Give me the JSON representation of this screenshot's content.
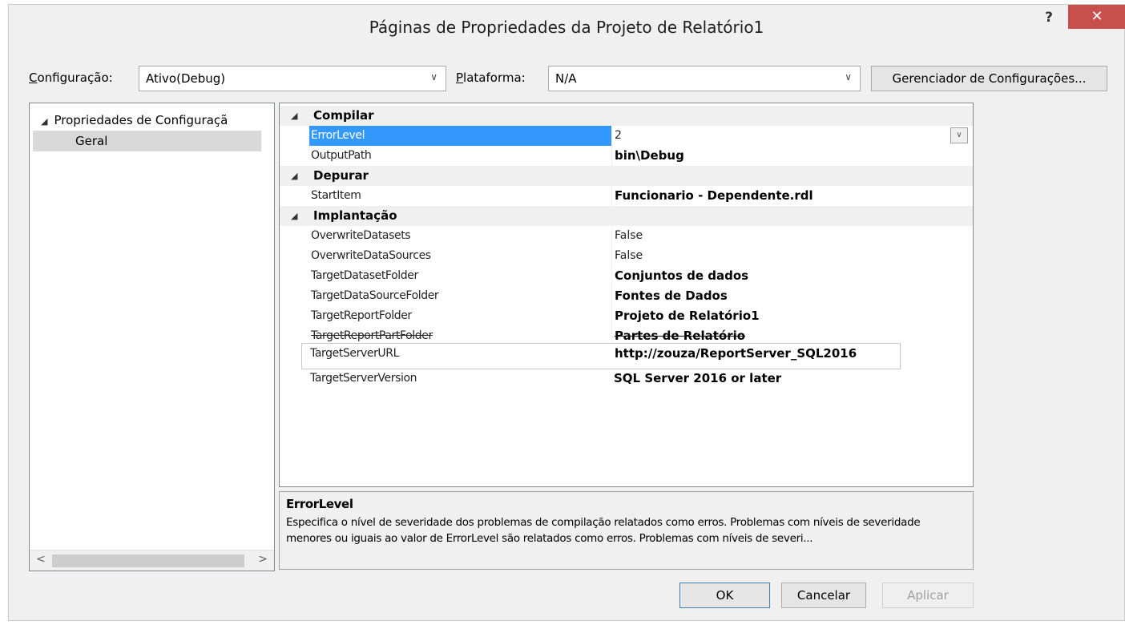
{
  "window": {
    "title": "Páginas de Propriedades da Projeto de Relatório1",
    "help": "?",
    "close": "✕"
  },
  "toolbar": {
    "config_label": "Configuração:",
    "config_value": "Ativo(Debug)",
    "platform_label": "Plataforma:",
    "platform_value": "N/A",
    "config_manager_button": "Gerenciador de Configurações..."
  },
  "tree": {
    "root": "Propriedades de Configuraçã",
    "child": "Geral"
  },
  "grid": {
    "categories": {
      "compile": "Compilar",
      "debug": "Depurar",
      "deploy": "Implantação"
    },
    "rows": [
      {
        "name": "ErrorLevel",
        "value": "2"
      },
      {
        "name": "OutputPath",
        "value": "bin\\Debug"
      },
      {
        "name": "StartItem",
        "value": "Funcionario - Dependente.rdl"
      },
      {
        "name": "OverwriteDatasets",
        "value": "False"
      },
      {
        "name": "OverwriteDataSources",
        "value": "False"
      },
      {
        "name": "TargetDatasetFolder",
        "value": "Conjuntos de dados"
      },
      {
        "name": "TargetDataSourceFolder",
        "value": "Fontes de Dados"
      },
      {
        "name": "TargetReportFolder",
        "value": "Projeto de Relatório1"
      },
      {
        "name": "TargetReportPartFolder",
        "value": "Partes de Relatório"
      },
      {
        "name": "TargetServerURL",
        "value": "http://zouza/ReportServer_SQL2016"
      },
      {
        "name": "TargetServerVersion",
        "value": "SQL Server 2016 or later"
      }
    ]
  },
  "description": {
    "title": "ErrorLevel",
    "text": "Especifica o nível de severidade dos problemas de compilação relatados como erros. Problemas com níveis de severidade menores ou iguais ao valor de ErrorLevel são relatados como erros. Problemas com níveis de severi..."
  },
  "buttons": {
    "ok": "OK",
    "cancel": "Cancelar",
    "apply": "Aplicar"
  }
}
